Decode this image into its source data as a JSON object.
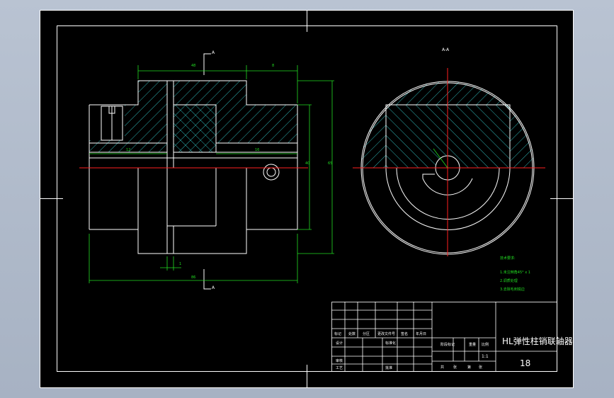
{
  "colors": {
    "background_outer": "#b0bac9",
    "sheet": "#000000",
    "line_white": "#ffffff",
    "center_red": "#ff2020",
    "dim_green": "#22dd22",
    "hatch_cyan": "#2fb5b5"
  },
  "drawing": {
    "section_mark_left_top": "A",
    "section_mark_left_bottom": "A",
    "section_title_right": "A-A",
    "dim_labels": {
      "top_left": "48",
      "top_right": "8",
      "inner_left": "12",
      "inner_right": "16",
      "right_inner": "40",
      "right_outer": "65",
      "bottom_gap": "1",
      "bottom_overall": "86"
    },
    "tech_requirements": {
      "title": "技术要求:",
      "items": [
        "1.未注倒角45° x 1",
        "2.调质处理",
        "3.去除毛刺锐边"
      ]
    }
  },
  "title_block": {
    "part_name": "HL弹性柱销联轴器",
    "drawing_number": "18",
    "scale": "1:1",
    "sign_row_labels": [
      "标记",
      "处数",
      "分区",
      "更改文件号",
      "签名",
      "年月日"
    ],
    "left_labels": [
      "设计",
      "审核",
      "工艺"
    ],
    "standard_label": "标准化",
    "approve_label": "批准",
    "stage_label": "阶段标记",
    "weight_label": "重量",
    "scale_label": "比例",
    "sheet_row": [
      "共",
      "张",
      "第",
      "张"
    ]
  },
  "icons": {
    "section_arrow": "arrow-up-icon"
  }
}
